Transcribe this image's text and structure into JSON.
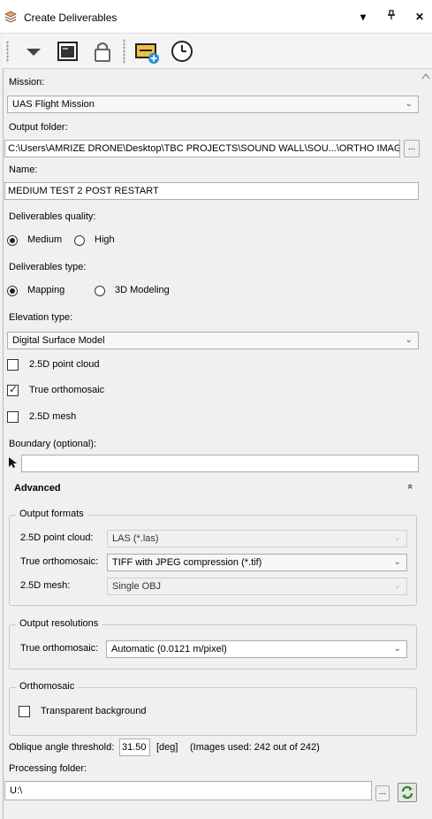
{
  "window": {
    "title": "Create Deliverables"
  },
  "toolbar": {
    "icons": [
      "dropdown-arrow-icon",
      "terminal-window-icon",
      "lock-icon",
      "add-deliverable-icon",
      "clock-icon"
    ]
  },
  "mission": {
    "label": "Mission:",
    "value": "UAS Flight Mission"
  },
  "output_folder": {
    "label": "Output folder:",
    "value": "C:\\Users\\AMRIZE DRONE\\Desktop\\TBC PROJECTS\\SOUND WALL\\SOU...\\ORTHO IMAGE",
    "browse_label": "..."
  },
  "name": {
    "label": "Name:",
    "value": "MEDIUM TEST 2 POST RESTART"
  },
  "quality": {
    "label": "Deliverables quality:",
    "options": [
      "Medium",
      "High"
    ],
    "selected": "Medium"
  },
  "type": {
    "label": "Deliverables type:",
    "options": [
      "Mapping",
      "3D Modeling"
    ],
    "selected": "Mapping"
  },
  "elevation": {
    "label": "Elevation type:",
    "value": "Digital Surface Model"
  },
  "checks": {
    "point_cloud": {
      "label": "2.5D point cloud",
      "checked": false
    },
    "orthomosaic": {
      "label": "True orthomosaic",
      "checked": true
    },
    "mesh": {
      "label": "2.5D mesh",
      "checked": false
    }
  },
  "boundary": {
    "label": "Boundary (optional):",
    "value": ""
  },
  "advanced": {
    "label": "Advanced",
    "collapse_icon": "«"
  },
  "output_formats": {
    "title": "Output formats",
    "point_cloud": {
      "label": "2.5D point cloud:",
      "value": "LAS (*.las)"
    },
    "orthomosaic": {
      "label": "True orthomosaic:",
      "value": "TIFF with JPEG compression (*.tif)"
    },
    "mesh": {
      "label": "2.5D mesh:",
      "value": "Single OBJ"
    }
  },
  "output_resolutions": {
    "title": "Output resolutions",
    "orthomosaic": {
      "label": "True orthomosaic:",
      "value": "Automatic (0.0121 m/pixel)"
    }
  },
  "orthomosaic_group": {
    "title": "Orthomosaic",
    "transparent": {
      "label": "Transparent background",
      "checked": false
    }
  },
  "oblique": {
    "label": "Oblique angle threshold:",
    "value": "31.50",
    "unit": "[deg]",
    "images_used": "(Images used: 242 out of 242)"
  },
  "processing_folder": {
    "label": "Processing folder:",
    "value": "U:\\",
    "browse_label": "..."
  }
}
